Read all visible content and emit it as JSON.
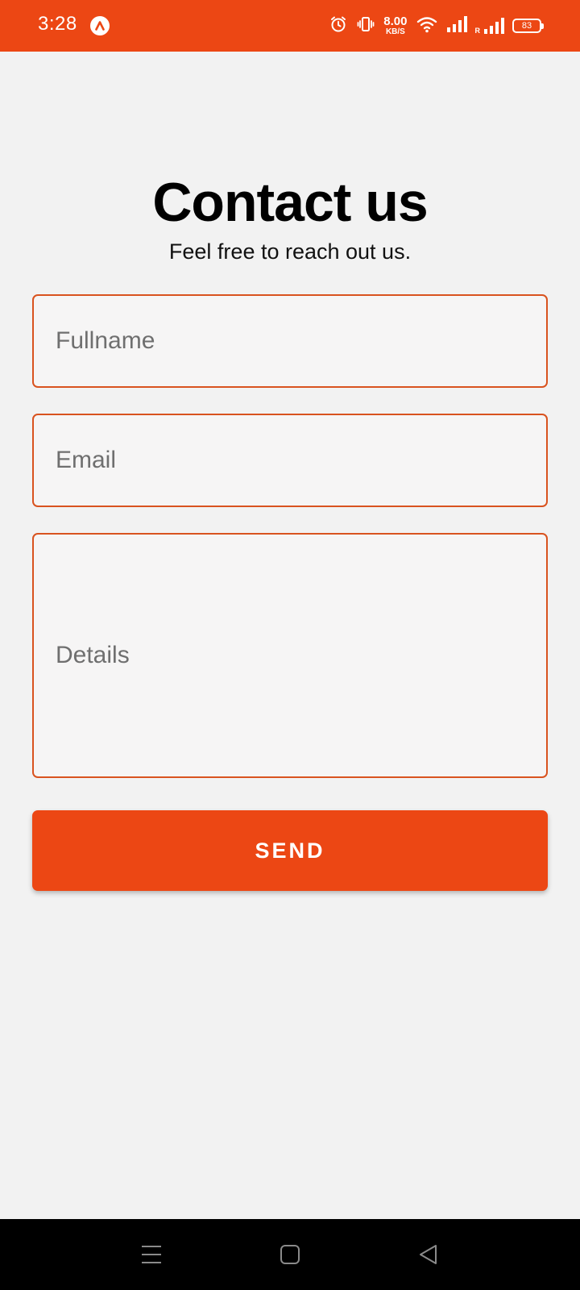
{
  "status_bar": {
    "time": "3:28",
    "network_speed_value": "8.00",
    "network_speed_unit": "KB/S",
    "roaming_label": "R",
    "battery_level": "83",
    "icons": [
      "app-badge-icon",
      "alarm-icon",
      "vibrate-icon",
      "wifi-icon",
      "signal-icon",
      "signal-roaming-icon",
      "battery-icon"
    ]
  },
  "header": {
    "title": "Contact us",
    "subtitle": "Feel free to reach out us."
  },
  "form": {
    "fullname_placeholder": "Fullname",
    "email_placeholder": "Email",
    "details_placeholder": "Details",
    "send_label": "SEND"
  },
  "nav": {
    "icons": [
      "menu-icon",
      "home-icon",
      "back-icon"
    ]
  },
  "colors": {
    "accent": "#ec4714",
    "field_border": "#d9531f",
    "background": "#f2f2f2",
    "nav_background": "#000000"
  }
}
